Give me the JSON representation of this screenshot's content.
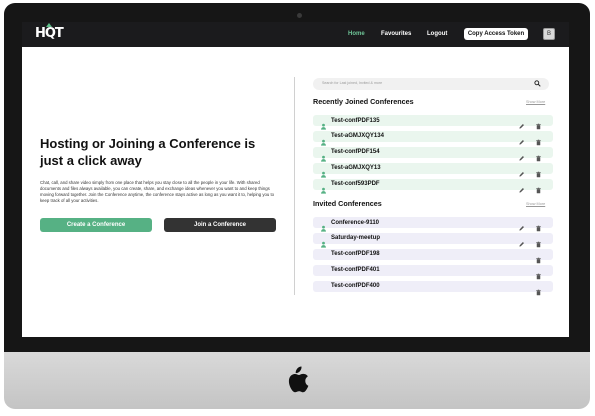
{
  "app": {
    "logo": "HQT"
  },
  "nav": {
    "home": "Home",
    "favourites": "Favourites",
    "logout": "Logout",
    "copy_token": "Copy Access Token",
    "avatar_initial": "B"
  },
  "hero": {
    "title": "Hosting or Joining a Conference is just a click away",
    "description": "Chat, call, and share video simply from one place that helps you stay close to all the people in your life. With shared documents and files always available, you can create, share, and exchange ideas whenever you want to and keep things moving forward together. Join the Conference anytime, the conference stays active as long as you want it to, helping you to keep track of all your activities.",
    "create_label": "Create a Conference",
    "join_label": "Join a Conference"
  },
  "search": {
    "placeholder": "Search for Last joined, Invited & more"
  },
  "recent": {
    "title": "Recently Joined Conferences",
    "show_more": "Show More",
    "items": [
      "Test-confPDF135",
      "Test-aGMJXQY134",
      "Test-confPDF154",
      "Test-aGMJXQY13",
      "Test-conf593PDF"
    ]
  },
  "invited": {
    "title": "Invited Conferences",
    "show_more": "Show More",
    "items": [
      "Conference-9110",
      "Saturday-meetup",
      "Test-confPDF198",
      "Test-confPDF401",
      "Test-confPDF400"
    ]
  },
  "colors": {
    "accent": "#56b184",
    "topbar": "#1b1b1d",
    "recent_row": "#eaf6ee",
    "invited_row": "#efeef8"
  }
}
